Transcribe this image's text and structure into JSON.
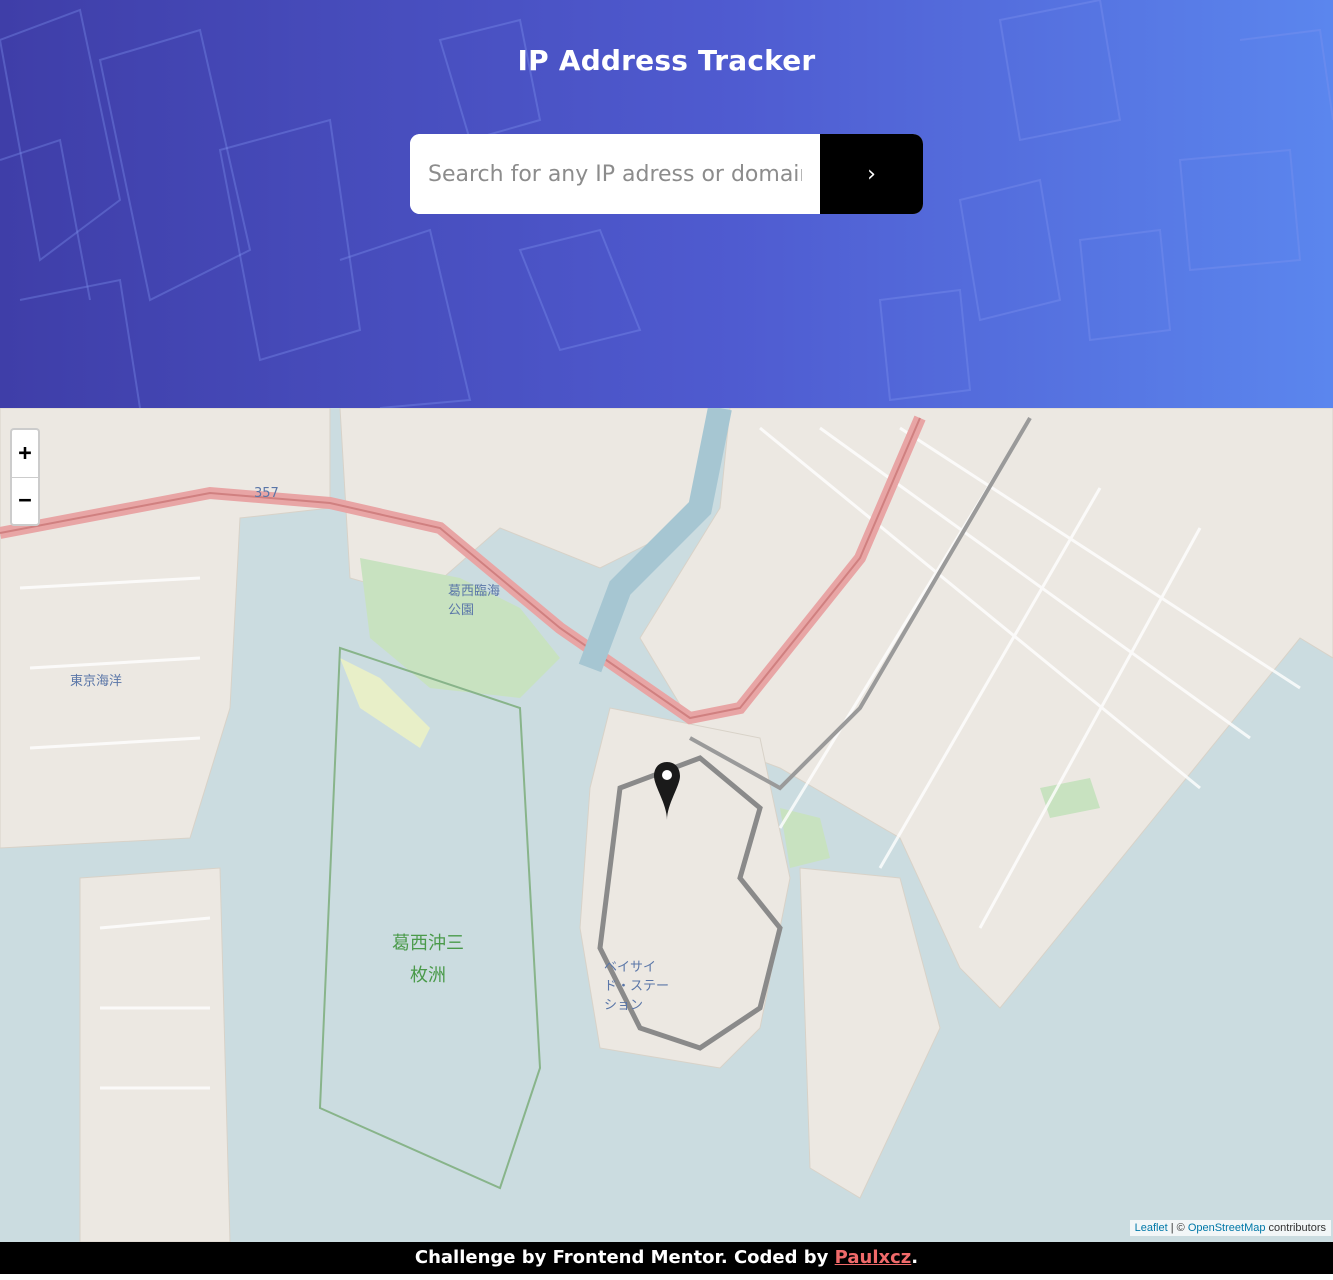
{
  "header": {
    "title": "IP Address Tracker",
    "background_colors": [
      "#3f3ea8",
      "#5b86ee"
    ]
  },
  "search": {
    "placeholder": "Search for any IP adress or domain",
    "value": "",
    "button_icon": "chevron-right-icon",
    "button_symbol": "›"
  },
  "map": {
    "zoom_in": "+",
    "zoom_out": "−",
    "marker_icon": "map-pin-icon",
    "labels": {
      "island": "葛西沖三\n枚洲",
      "resort": "ベイサイ\nド・ステー\nション",
      "park": "葛西臨海\n公園",
      "tokyo_station": "東京海洋",
      "road_357": "357"
    },
    "attribution": {
      "leaflet": "Leaflet",
      "separator": " | © ",
      "osm": "OpenStreetMap",
      "suffix": " contributors"
    }
  },
  "footer": {
    "text": "Challenge by Frontend Mentor. Coded by ",
    "author": "Paulxcz",
    "end": "."
  }
}
